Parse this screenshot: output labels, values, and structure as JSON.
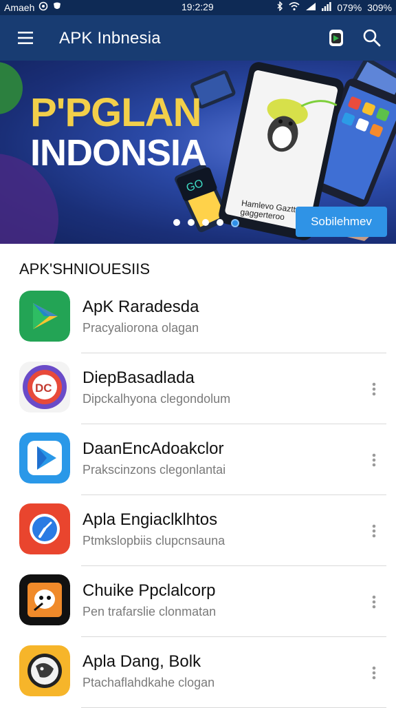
{
  "status_bar": {
    "carrier": "Amaeh",
    "time": "19:2:29",
    "battery1": "079%",
    "battery2": "309%"
  },
  "app_bar": {
    "title": "APK Inbnesia",
    "menu_icon": "hamburger-menu-icon",
    "search_icon": "search-icon"
  },
  "banner": {
    "title_line1": "P'PGLAN",
    "title_line2": "INDONSIA",
    "phone_caption_line1": "Hamlevo Gazttto",
    "phone_caption_line2": "gaggerteroo",
    "cta_label": "Sobilehmev",
    "slides_total": 5,
    "active_slide": 5
  },
  "section": {
    "header": "APK'SHNIOUESIIS"
  },
  "apps": [
    {
      "name": "ApK Raradesda",
      "subtitle": "Pracyaliorona olagan",
      "icon": "play-store-icon",
      "has_menu": false
    },
    {
      "name": "DiepBasadlada",
      "subtitle": "Dipckalhyona clegondolum",
      "icon": "circle-logo-icon",
      "has_menu": true
    },
    {
      "name": "DaanEncAdoakclor",
      "subtitle": "Prakscinzons clegonlantai",
      "icon": "play-triangle-icon",
      "has_menu": true
    },
    {
      "name": "Apla Engiaclklhtos",
      "subtitle": "Ptmkslopbiis clupcnsauna",
      "icon": "clock-icon",
      "has_menu": true
    },
    {
      "name": "Chuike Ppclalcorp",
      "subtitle": "Pen trafarslie clonmatan",
      "icon": "mascot-icon",
      "has_menu": true
    },
    {
      "name": "Apla Dang, Bolk",
      "subtitle": "Ptachaflahdkahe clogan",
      "icon": "badge-icon",
      "has_menu": true
    }
  ],
  "colors": {
    "app_bar": "#183c72",
    "accent": "#2f93e6",
    "banner_title_yellow": "#f2cf4a"
  }
}
